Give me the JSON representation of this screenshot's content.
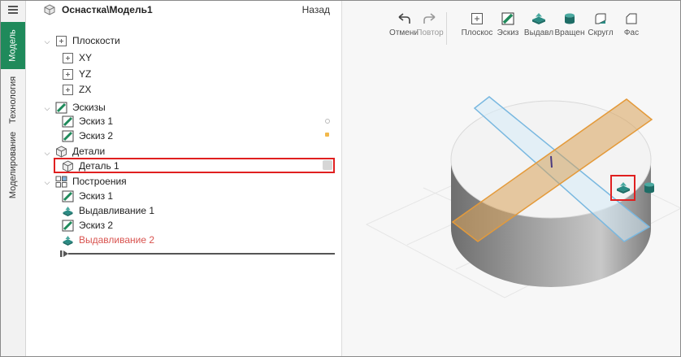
{
  "sidetabs": [
    {
      "label": "Модель",
      "active": true
    },
    {
      "label": "Технология",
      "active": false
    },
    {
      "label": "Моделирование",
      "active": false
    }
  ],
  "panel": {
    "title": "Оснастка\\Модель1",
    "back_label": "Назад"
  },
  "tree": {
    "planes": {
      "label": "Плоскости",
      "children": [
        "XY",
        "YZ",
        "ZX"
      ]
    },
    "sketches": {
      "label": "Эскизы",
      "children": [
        "Эскиз 1",
        "Эскиз 2"
      ]
    },
    "parts": {
      "label": "Детали",
      "children": [
        "Деталь 1"
      ]
    },
    "constructions": {
      "label": "Построения",
      "children": [
        "Эскиз 1",
        "Выдавливание 1",
        "Эскиз 2",
        "Выдавливание 2"
      ]
    }
  },
  "toolbar": [
    {
      "label": "Отмени",
      "icon": "undo-icon",
      "disabled": false
    },
    {
      "label": "Повтор",
      "icon": "redo-icon",
      "disabled": true
    },
    {
      "label": "Плоскос",
      "icon": "plane-icon",
      "disabled": false
    },
    {
      "label": "Эскиз",
      "icon": "sketch-icon",
      "disabled": false
    },
    {
      "label": "Выдавл",
      "icon": "extrude-icon",
      "disabled": false
    },
    {
      "label": "Вращен",
      "icon": "revolve-icon",
      "disabled": false
    },
    {
      "label": "Скругл",
      "icon": "fillet-icon",
      "disabled": false
    },
    {
      "label": "Фас",
      "icon": "chamfer-icon",
      "disabled": false
    }
  ],
  "colors": {
    "accent_green": "#1f8a5b",
    "highlight_red": "#e02020",
    "sketch_plane_blue": "#79b8e0",
    "extrude_orange": "#e49a3a",
    "error_label": "#d9534f"
  }
}
